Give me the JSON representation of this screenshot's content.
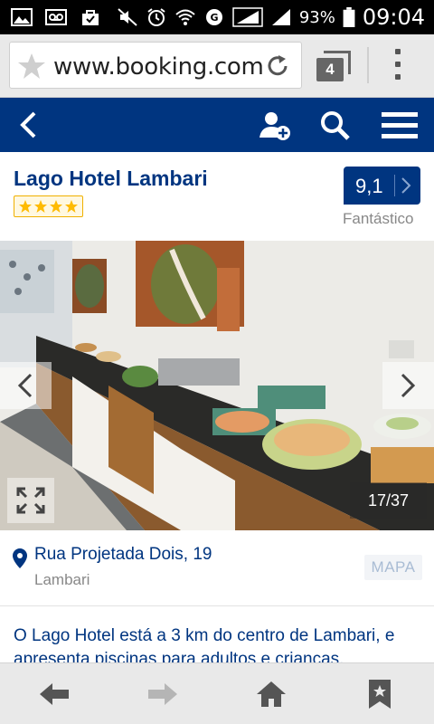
{
  "status_bar": {
    "battery": "93%",
    "time": "09:04"
  },
  "browser": {
    "url": "www.booking.com",
    "tab_count": "4"
  },
  "hotel": {
    "name": "Lago Hotel Lambari",
    "star_rating": 4,
    "score": "9,1",
    "score_label": "Fantástico"
  },
  "gallery": {
    "counter": "17/37"
  },
  "address": {
    "street": "Rua Projetada Dois, 19",
    "city": "Lambari",
    "map_label": "MAPA"
  },
  "description": {
    "text": "O Lago Hotel está a 3 km do centro de Lambari, e apresenta piscinas para adultos e crianças."
  },
  "colors": {
    "brand": "#003580",
    "star": "#febb02"
  }
}
